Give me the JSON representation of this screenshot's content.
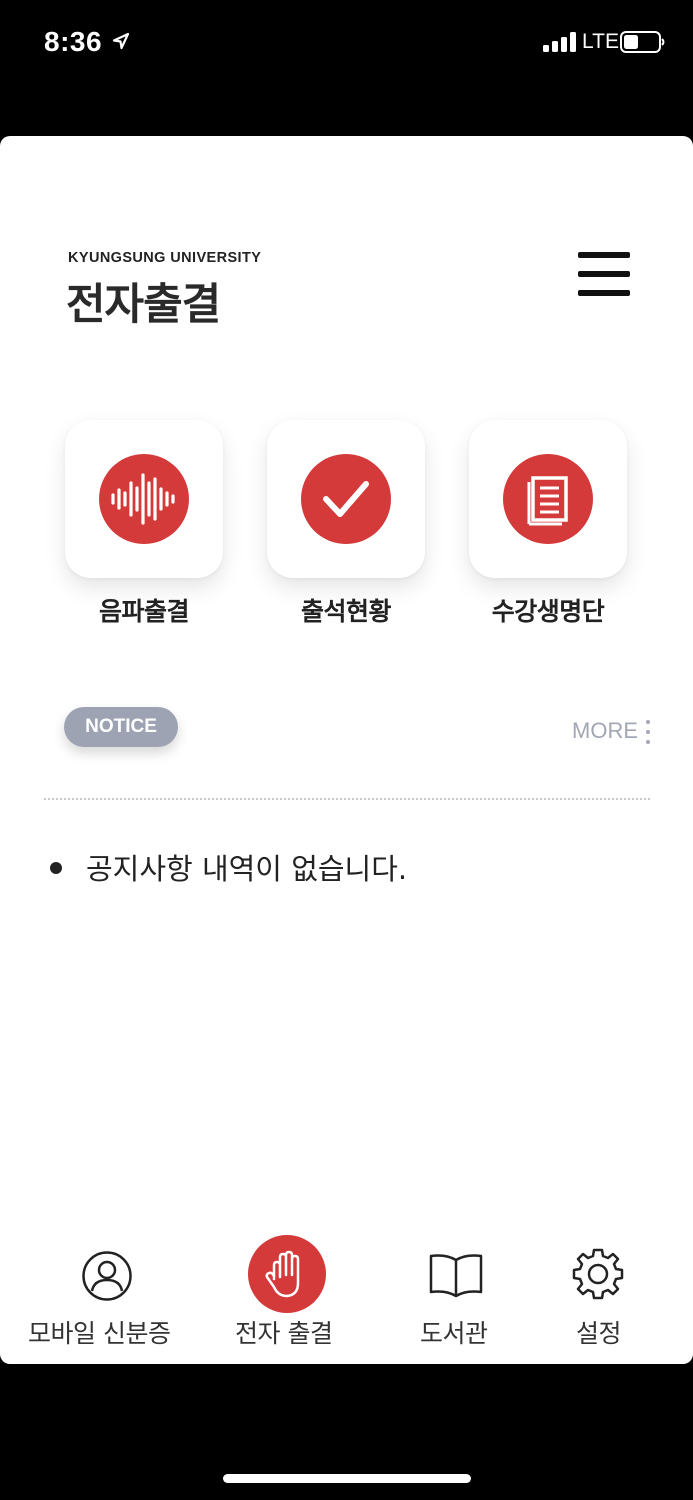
{
  "status_bar": {
    "time": "8:36",
    "network": "LTE",
    "icons": [
      "location-arrow-icon",
      "signal-bars-icon",
      "battery-icon"
    ]
  },
  "header": {
    "university": "KYUNGSUNG UNIVERSITY",
    "title": "전자출결",
    "menu_icon": "hamburger-menu-icon"
  },
  "quick_menu": [
    {
      "label": "음파출결",
      "icon": "sound-wave-icon"
    },
    {
      "label": "출석현황",
      "icon": "checkmark-icon"
    },
    {
      "label": "수강생명단",
      "icon": "notebook-icon"
    }
  ],
  "notice": {
    "badge": "NOTICE",
    "more_label": "MORE",
    "items": [
      "공지사항 내역이 없습니다."
    ]
  },
  "bottom_nav": [
    {
      "label": "모바일 신분증",
      "icon": "person-icon",
      "active": false
    },
    {
      "label": "전자 출결",
      "icon": "raised-hand-icon",
      "active": true
    },
    {
      "label": "도서관",
      "icon": "open-book-icon",
      "active": false
    },
    {
      "label": "설정",
      "icon": "gear-icon",
      "active": false
    }
  ],
  "colors": {
    "accent": "#d43a3a",
    "badge": "#9ea3b3",
    "more_text": "#a2a7b5",
    "status_bar_bg": "#000000"
  }
}
